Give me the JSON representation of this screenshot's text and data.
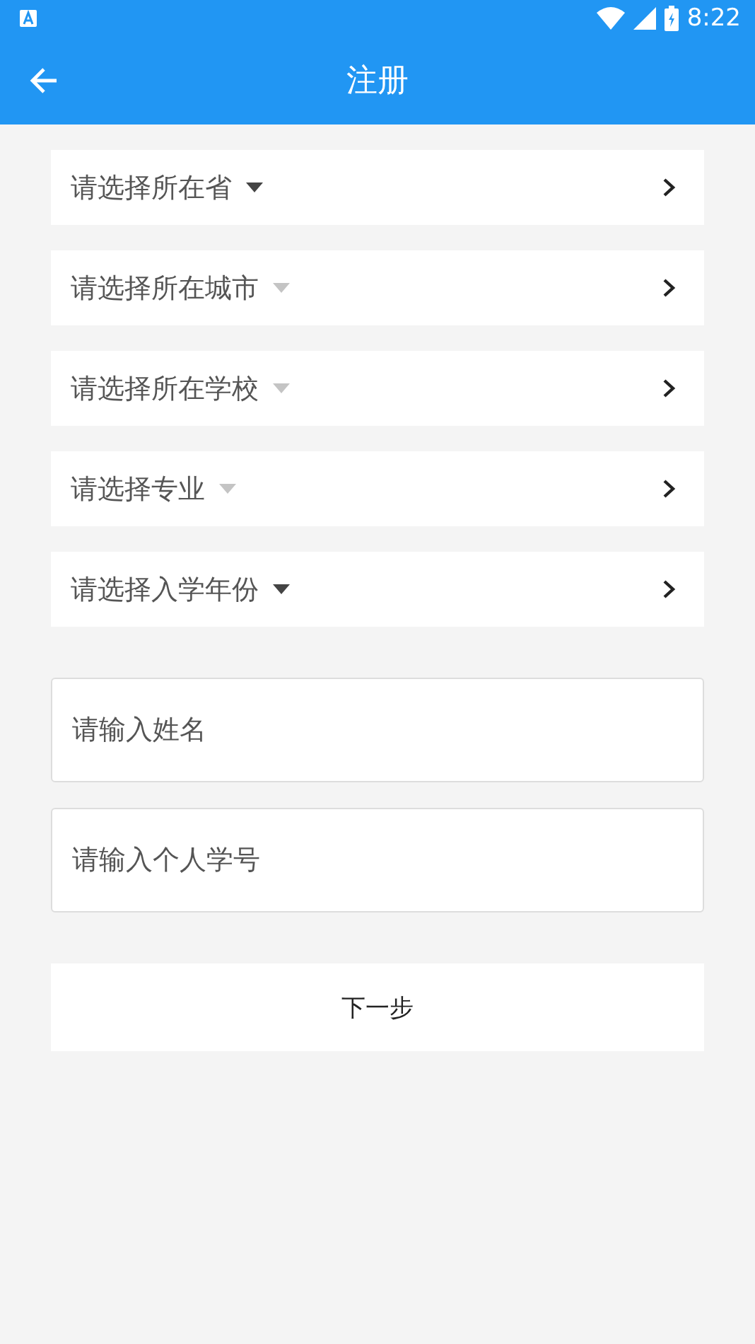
{
  "status_bar": {
    "time": "8:22"
  },
  "app_bar": {
    "title": "注册"
  },
  "selectors": [
    {
      "label": "请选择所在省",
      "disabled": false
    },
    {
      "label": "请选择所在城市",
      "disabled": true
    },
    {
      "label": "请选择所在学校",
      "disabled": true
    },
    {
      "label": "请选择专业",
      "disabled": true
    },
    {
      "label": "请选择入学年份",
      "disabled": false
    }
  ],
  "fields": [
    {
      "placeholder": "请输入姓名"
    },
    {
      "placeholder": "请输入个人学号"
    }
  ],
  "next_button": {
    "label": "下一步"
  }
}
